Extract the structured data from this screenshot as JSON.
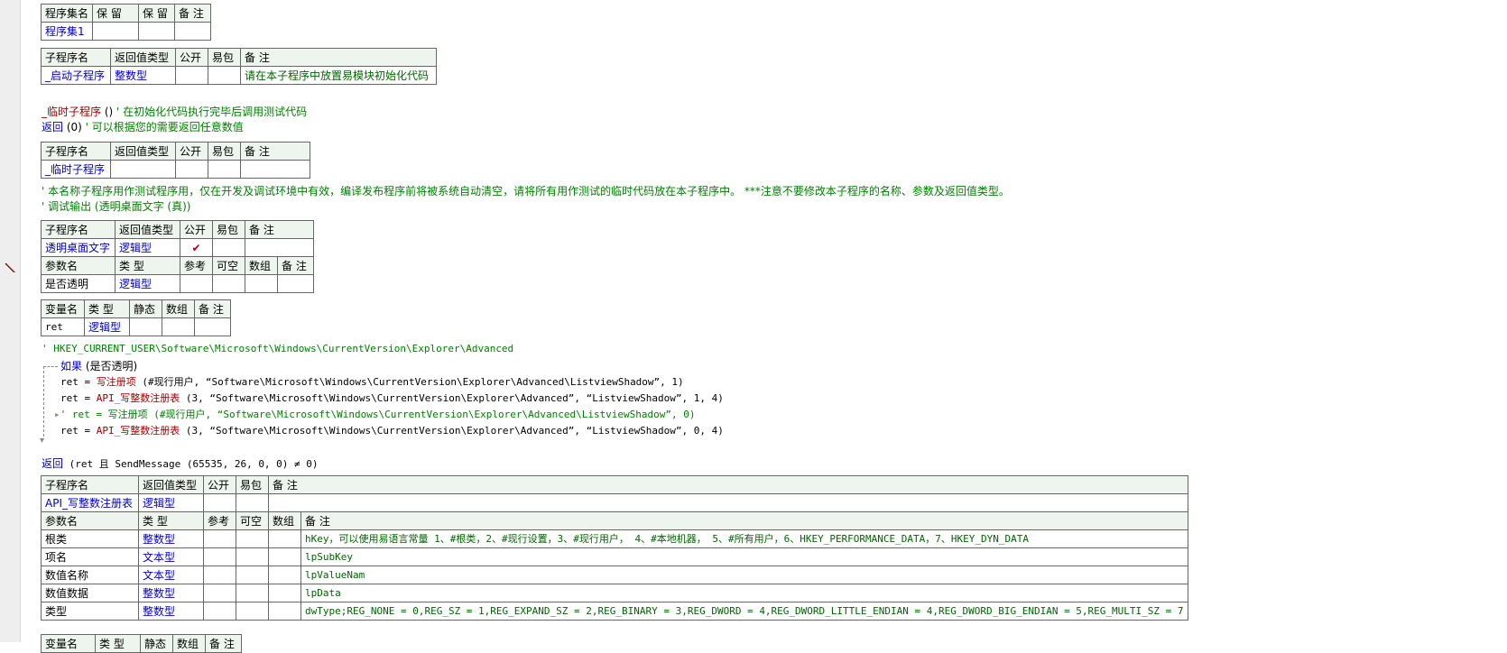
{
  "assembly_table": {
    "headers": [
      "程序集名",
      "保 留",
      "保 留",
      "备 注"
    ],
    "row": [
      "程序集1",
      "",
      "",
      ""
    ]
  },
  "startup_table": {
    "headers": [
      "子程序名",
      "返回值类型",
      "公开",
      "易包",
      "备 注"
    ],
    "row": [
      "_启动子程序",
      "整数型",
      "",
      "",
      "请在本子程序中放置易模块初始化代码"
    ]
  },
  "code1": {
    "line1_name": "_临时子程序",
    "line1_paren": " () ",
    "line1_comment": "' 在初始化代码执行完毕后调用测试代码",
    "line2_kw": "返回",
    "line2_arg": " (0) ",
    "line2_comment": "' 可以根据您的需要返回任意数值"
  },
  "temp_table": {
    "headers": [
      "子程序名",
      "返回值类型",
      "公开",
      "易包",
      "备 注"
    ],
    "row": [
      "_临时子程序",
      "",
      "",
      "",
      ""
    ]
  },
  "comment_temp": "' 本名称子程序用作测试程序用，仅在开发及调试环境中有效，编译发布程序前将被系统自动清空，请将所有用作测试的临时代码放在本子程序中。 ***注意不要修改本子程序的名称、参数及返回值类型。",
  "comment_debug": "' 调试输出 (透明桌面文字 (真))",
  "transparent_table": {
    "headers": [
      "子程序名",
      "返回值类型",
      "公开",
      "易包",
      "备 注"
    ],
    "row": [
      "透明桌面文字",
      "逻辑型",
      "✔",
      "",
      ""
    ],
    "param_headers": [
      "参数名",
      "类 型",
      "参考",
      "可空",
      "数组",
      "备 注"
    ],
    "param_row": [
      "是否透明",
      "逻辑型",
      "",
      "",
      "",
      ""
    ]
  },
  "var_table": {
    "headers": [
      "变量名",
      "类 型",
      "静态",
      "数组",
      "备 注"
    ],
    "row": [
      "ret",
      "逻辑型",
      "",
      "",
      ""
    ]
  },
  "code2": {
    "reg_comment": "' HKEY_CURRENT_USER\\Software\\Microsoft\\Windows\\CurrentVersion\\Explorer\\Advanced",
    "if_kw": "如果",
    "if_cond": " (是否透明)",
    "l1_a": "ret = ",
    "l1_fn": "写注册项",
    "l1_args": " (#现行用户, “Software\\Microsoft\\Windows\\CurrentVersion\\Explorer\\Advanced\\ListviewShadow”, 1)",
    "l2_a": "ret = ",
    "l2_fn": "API_写整数注册表",
    "l2_args": " (3, “Software\\Microsoft\\Windows\\CurrentVersion\\Explorer\\Advanced”, “ListviewShadow”, 1, 4)",
    "l3": "' ret = 写注册项 (#现行用户, “Software\\Microsoft\\Windows\\CurrentVersion\\Explorer\\Advanced\\ListviewShadow”, 0)",
    "l4_a": "ret = ",
    "l4_fn": "API_写整数注册表",
    "l4_args": " (3, “Software\\Microsoft\\Windows\\CurrentVersion\\Explorer\\Advanced”, “ListviewShadow”, 0, 4)",
    "ret_kw": "返回",
    "ret_args": " (ret 且 SendMessage (65535, 26, 0, 0) ≠ 0)"
  },
  "api_table": {
    "headers": [
      "子程序名",
      "返回值类型",
      "公开",
      "易包",
      "备 注"
    ],
    "row": [
      "API_写整数注册表",
      "逻辑型",
      "",
      "",
      ""
    ],
    "param_headers": [
      "参数名",
      "类 型",
      "参考",
      "可空",
      "数组",
      "备 注"
    ],
    "params": [
      [
        "根类",
        "整数型",
        "",
        "",
        "",
        "hKey，可以使用易语言常量 1、#根类，2、#现行设置，3、#现行用户， 4、#本地机器， 5、#所有用户，6、HKEY_PERFORMANCE_DATA，7、HKEY_DYN_DATA"
      ],
      [
        "项名",
        "文本型",
        "",
        "",
        "",
        "lpSubKey"
      ],
      [
        "数值名称",
        "文本型",
        "",
        "",
        "",
        "lpValueNam"
      ],
      [
        "数值数据",
        "整数型",
        "",
        "",
        "",
        "lpData"
      ],
      [
        "类型",
        "整数型",
        "",
        "",
        "",
        "dwType;REG_NONE = 0,REG_SZ = 1,REG_EXPAND_SZ = 2,REG_BINARY = 3,REG_DWORD = 4,REG_DWORD_LITTLE_ENDIAN = 4,REG_DWORD_BIG_ENDIAN = 5,REG_MULTI_SZ = 7"
      ]
    ]
  },
  "var_table2": {
    "headers": [
      "变量名",
      "类 型",
      "静态",
      "数组",
      "备 注"
    ]
  },
  "icons": {
    "gutter_marker": "pencil-icon",
    "check": "check-icon"
  }
}
